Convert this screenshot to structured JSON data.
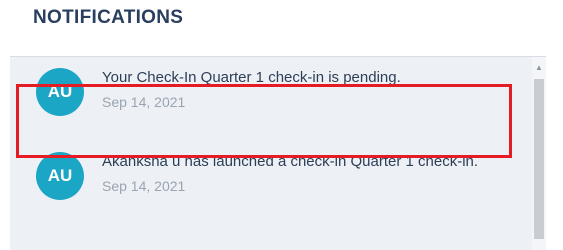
{
  "header": {
    "title": "NOTIFICATIONS"
  },
  "notifications": [
    {
      "avatar": "AU",
      "message": "Your Check-In Quarter 1 check-in is pending.",
      "date": "Sep 14, 2021"
    },
    {
      "avatar": "AU",
      "message": "Akanksha u has launched a check-in Quarter 1 check-in.",
      "date": "Sep 14, 2021"
    }
  ],
  "colors": {
    "avatar_bg": "#1aa6c4",
    "title": "#2a3f5f",
    "panel_bg": "#edf1f6",
    "highlight_border": "#e51c23"
  },
  "icons": {
    "scroll_up": "triangle-up"
  }
}
